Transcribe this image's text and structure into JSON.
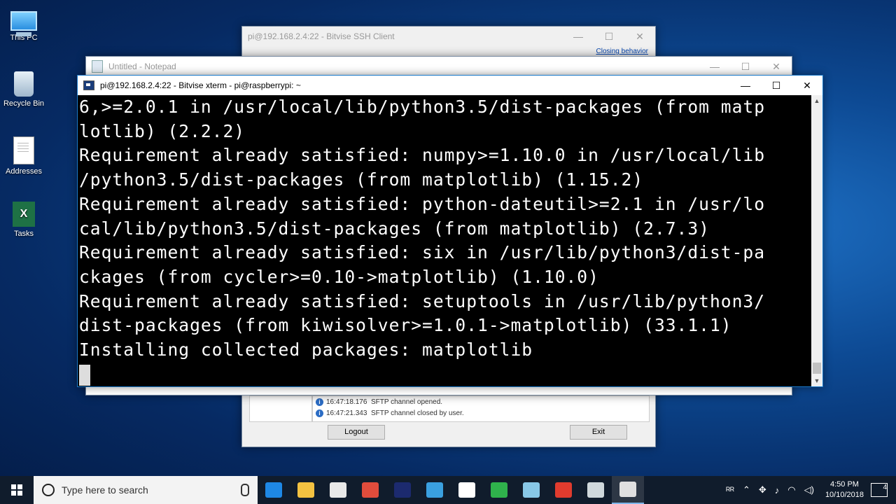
{
  "desktop": {
    "icons": [
      {
        "label": "This PC",
        "icon": "computer-icon"
      },
      {
        "label": "Recycle Bin",
        "icon": "recycle-bin-icon"
      },
      {
        "label": "Addresses",
        "icon": "document-icon"
      },
      {
        "label": "Tasks",
        "icon": "excel-icon"
      }
    ]
  },
  "bitvise": {
    "title": "pi@192.168.2.4:22 - Bitvise SSH Client",
    "closing_behavior": "Closing behavior",
    "log": [
      {
        "time": "16:47:18.176",
        "message": "SFTP channel opened."
      },
      {
        "time": "16:47:21.343",
        "message": "SFTP channel closed by user."
      }
    ],
    "logout_label": "Logout",
    "exit_label": "Exit"
  },
  "notepad": {
    "title": "Untitled - Notepad"
  },
  "xterm": {
    "title": "pi@192.168.2.4:22 - Bitvise xterm - pi@raspberrypi: ~",
    "lines": [
      "6,>=2.0.1 in /usr/local/lib/python3.5/dist-packages (from matp",
      "lotlib) (2.2.2)",
      "Requirement already satisfied: numpy>=1.10.0 in /usr/local/lib",
      "/python3.5/dist-packages (from matplotlib) (1.15.2)",
      "Requirement already satisfied: python-dateutil>=2.1 in /usr/lo",
      "cal/lib/python3.5/dist-packages (from matplotlib) (2.7.3)",
      "Requirement already satisfied: six in /usr/lib/python3/dist-pa",
      "ckages (from cycler>=0.10->matplotlib) (1.10.0)",
      "Requirement already satisfied: setuptools in /usr/lib/python3/",
      "dist-packages (from kiwisolver>=1.0.1->matplotlib) (33.1.1)",
      "Installing collected packages: matplotlib"
    ]
  },
  "window_controls": {
    "minimize": "—",
    "maximize": "☐",
    "close": "✕"
  },
  "taskbar": {
    "search_placeholder": "Type here to search",
    "apps": [
      {
        "name": "edge",
        "color": "#1e88e5"
      },
      {
        "name": "file-explorer",
        "color": "#f3c241"
      },
      {
        "name": "store",
        "color": "#e8e8e8"
      },
      {
        "name": "chrome",
        "color": "#e04c3c"
      },
      {
        "name": "sublime-merge",
        "color": "#1c2a6e"
      },
      {
        "name": "v2-app",
        "color": "#3aa0e0"
      },
      {
        "name": "mail",
        "color": "#ffffff"
      },
      {
        "name": "camtasia",
        "color": "#2fb24c"
      },
      {
        "name": "notepad-app",
        "color": "#88c8e8"
      },
      {
        "name": "camtasia-red",
        "color": "#e03b2e"
      },
      {
        "name": "bitvise-ssh",
        "color": "#cfd8dc"
      },
      {
        "name": "bitvise-xterm",
        "color": "#e0e0e0"
      }
    ],
    "time": "4:50 PM",
    "date": "10/10/2018",
    "notifications": "4"
  }
}
